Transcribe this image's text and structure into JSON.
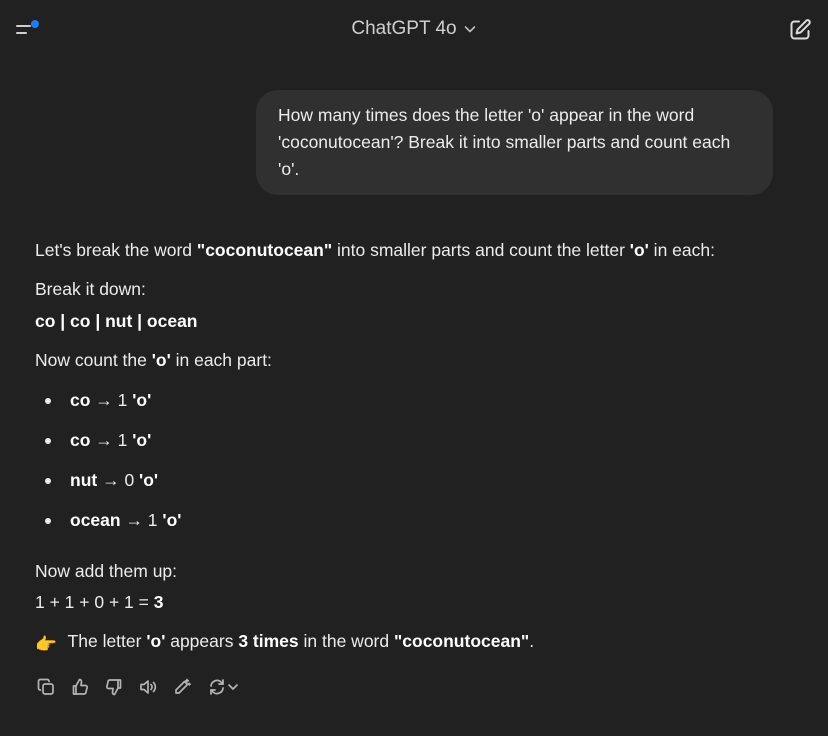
{
  "header": {
    "model_name": "ChatGPT 4o",
    "icons": [
      "sidebar-menu-icon",
      "chevron-down-icon",
      "new-chat-icon"
    ],
    "accent_dot_color": "#1e7bff"
  },
  "user_message": {
    "text": "How many times does the letter 'o' appear in the word 'coconutocean'? Break it into smaller parts and count each 'o'."
  },
  "assistant_message": {
    "intro": {
      "before": "Let's break the word ",
      "word": "\"coconutocean\"",
      "middle": " into smaller parts and count the letter ",
      "letter": "'o'",
      "after": " in each:"
    },
    "break_label": "Break it down:",
    "parts_line": "co | co | nut | ocean",
    "count_intro": {
      "before": "Now count the ",
      "letter": "'o'",
      "after": " in each part:"
    },
    "bullets": [
      {
        "part": "co",
        "arrow": " → 1 ",
        "count_label": "'o'"
      },
      {
        "part": "co",
        "arrow": " → 1 ",
        "count_label": "'o'"
      },
      {
        "part": "nut",
        "arrow": " → 0 ",
        "count_label": "'o'"
      },
      {
        "part": "ocean",
        "arrow": " → 1 ",
        "count_label": "'o'"
      }
    ],
    "add_label": "Now add them up:",
    "sum": {
      "expression": "1 + 1 + 0 + 1 = ",
      "result": "3"
    },
    "final": {
      "emoji": "👉",
      "before": " The letter ",
      "letter": "'o'",
      "middle": " appears ",
      "count": "3 times",
      "after_count": " in the word ",
      "word": "\"coconutocean\"",
      "end": "."
    }
  },
  "actions": {
    "icons": [
      "copy-icon",
      "thumbs-up-icon",
      "thumbs-down-icon",
      "read-aloud-icon",
      "edit-in-canvas-icon",
      "regenerate-icon"
    ]
  }
}
